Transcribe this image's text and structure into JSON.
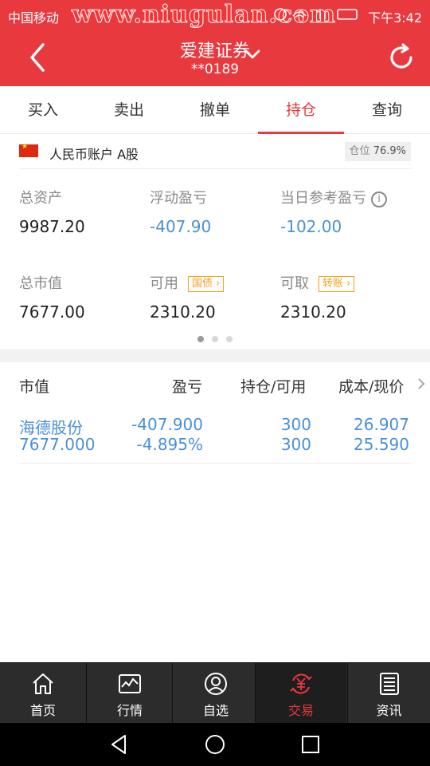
{
  "status_bar": {
    "carrier": "中国移动",
    "watermark": "www.niugulan.com",
    "time": "下午3:42"
  },
  "header": {
    "title": "爱建证券",
    "account_masked": "**0189"
  },
  "tabs": [
    {
      "label": "买入"
    },
    {
      "label": "卖出"
    },
    {
      "label": "撤单"
    },
    {
      "label": "持仓",
      "active": true
    },
    {
      "label": "查询"
    }
  ],
  "account": {
    "name": "人民币账户 A股",
    "position_label": "仓位",
    "position_value": "76.9%"
  },
  "assets": {
    "total_assets": {
      "label": "总资产",
      "value": "9987.20"
    },
    "floating_pnl": {
      "label": "浮动盈亏",
      "value": "-407.90"
    },
    "daily_ref_pnl": {
      "label": "当日参考盈亏",
      "value": "-102.00"
    },
    "market_value": {
      "label": "总市值",
      "value": "7677.00"
    },
    "available": {
      "label": "可用",
      "value": "2310.20",
      "tag": "国债"
    },
    "withdrawable": {
      "label": "可取",
      "value": "2310.20",
      "tag": "转账"
    }
  },
  "pager": {
    "count": 3,
    "active_index": 0
  },
  "holdings": {
    "columns": [
      "市值",
      "盈亏",
      "持仓/可用",
      "成本/现价"
    ],
    "rows": [
      {
        "name": "海德股份",
        "market_value": "7677.000",
        "pnl": "-407.900",
        "pnl_pct": "-4.895%",
        "position": "300",
        "available": "300",
        "cost": "26.907",
        "price": "25.590"
      }
    ]
  },
  "bottom_nav": [
    {
      "label": "首页",
      "icon": "home-icon"
    },
    {
      "label": "行情",
      "icon": "chart-icon"
    },
    {
      "label": "自选",
      "icon": "user-icon"
    },
    {
      "label": "交易",
      "icon": "trade-yen-icon",
      "active": true
    },
    {
      "label": "资讯",
      "icon": "news-icon"
    }
  ],
  "colors": {
    "brand_red": "#e8393f",
    "value_blue": "#4a90d6",
    "tag_orange": "#f0a020"
  }
}
